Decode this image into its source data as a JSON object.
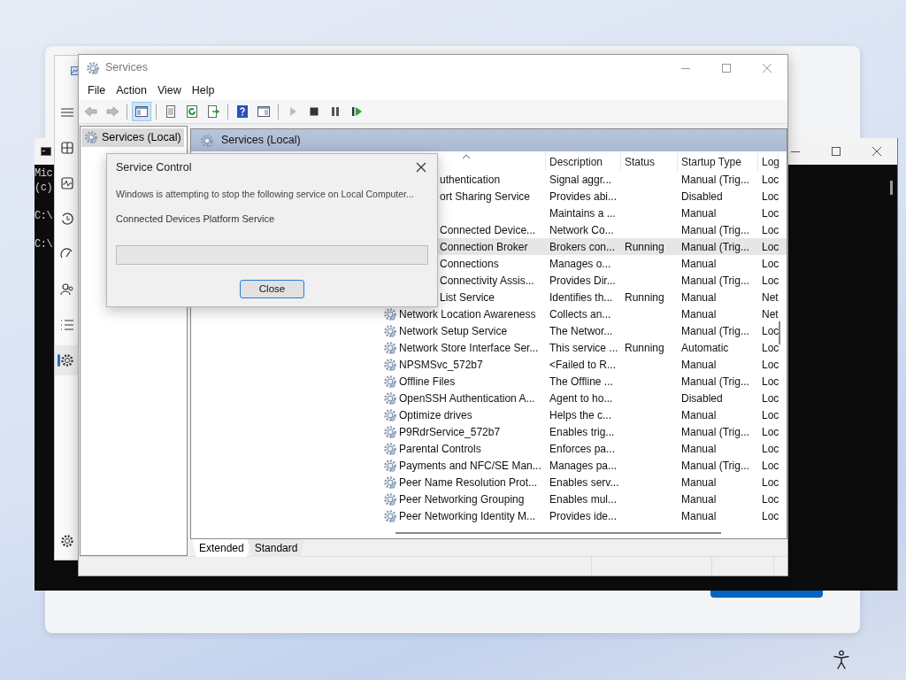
{
  "console": {
    "lines": [
      {
        "kind": "output",
        "text": "Mic"
      },
      {
        "kind": "output",
        "text": "(c)"
      },
      {
        "kind": "prompt",
        "text": "C:\\"
      },
      {
        "kind": "prompt",
        "text": "C:\\"
      }
    ]
  },
  "task_manager": {
    "nav": [
      {
        "kind": "menu",
        "selected": false
      },
      {
        "kind": "processes",
        "selected": false
      },
      {
        "kind": "performance",
        "selected": false
      },
      {
        "kind": "history",
        "selected": false
      },
      {
        "kind": "startup",
        "selected": false
      },
      {
        "kind": "users",
        "selected": false
      },
      {
        "kind": "details",
        "selected": false
      },
      {
        "kind": "services",
        "selected": true
      },
      {
        "kind": "settings",
        "selected": false
      }
    ]
  },
  "services": {
    "title": "Services",
    "menu": [
      "File",
      "Action",
      "View",
      "Help"
    ],
    "toolbar": [
      [
        {
          "kind": "back",
          "disabled": true,
          "pressed": false
        },
        {
          "kind": "forward",
          "disabled": true,
          "pressed": false
        }
      ],
      [
        {
          "kind": "tree",
          "disabled": false,
          "pressed": true
        }
      ],
      [
        {
          "kind": "properties",
          "disabled": false,
          "pressed": false
        },
        {
          "kind": "refresh",
          "disabled": false,
          "pressed": false
        },
        {
          "kind": "export",
          "disabled": false,
          "pressed": false
        }
      ],
      [
        {
          "kind": "help",
          "disabled": false,
          "pressed": false
        },
        {
          "kind": "action_pane",
          "disabled": false,
          "pressed": false
        }
      ],
      [
        {
          "kind": "start",
          "disabled": true,
          "pressed": false
        },
        {
          "kind": "stop",
          "disabled": false,
          "pressed": false
        },
        {
          "kind": "pause",
          "disabled": false,
          "pressed": false
        },
        {
          "kind": "resume",
          "disabled": false,
          "pressed": false
        }
      ]
    ],
    "tree": [
      {
        "label": "Services (Local)",
        "selected": true
      }
    ],
    "pane_title": "Services (Local)",
    "columns": [
      {
        "sorted": true
      },
      {
        "label": "Description"
      },
      {
        "label": "Status"
      },
      {
        "label": "Startup Type"
      },
      {
        "label": "Log"
      }
    ],
    "rows": [
      {
        "kind": "covered",
        "name": "uthentication",
        "description": "Signal aggr...",
        "startup_type": "Manual (Trig...",
        "log_on_as": "Loc",
        "selected": false
      },
      {
        "kind": "covered",
        "name": "ort Sharing Service",
        "description": "Provides abi...",
        "startup_type": "Disabled",
        "log_on_as": "Loc",
        "selected": false
      },
      {
        "kind": "covered",
        "description": "Maintains a ...",
        "startup_type": "Manual",
        "log_on_as": "Loc",
        "selected": false
      },
      {
        "kind": "covered",
        "name": "Connected Device...",
        "description": "Network Co...",
        "startup_type": "Manual (Trig...",
        "log_on_as": "Loc",
        "selected": false
      },
      {
        "kind": "covered",
        "name": "Connection Broker",
        "description": "Brokers con...",
        "status": "Running",
        "startup_type": "Manual (Trig...",
        "log_on_as": "Loc",
        "selected": true
      },
      {
        "kind": "covered",
        "name": "Connections",
        "description": "Manages o...",
        "startup_type": "Manual",
        "log_on_as": "Loc",
        "selected": false
      },
      {
        "kind": "covered",
        "name": "Connectivity Assis...",
        "description": "Provides Dir...",
        "startup_type": "Manual (Trig...",
        "log_on_as": "Loc",
        "selected": false
      },
      {
        "kind": "covered",
        "name": "List Service",
        "description": "Identifies th...",
        "status": "Running",
        "startup_type": "Manual",
        "log_on_as": "Net",
        "selected": false
      },
      {
        "kind": "service",
        "name": "Network Location Awareness",
        "description": "Collects an...",
        "startup_type": "Manual",
        "log_on_as": "Net",
        "selected": false
      },
      {
        "kind": "service",
        "name": "Network Setup Service",
        "description": "The Networ...",
        "startup_type": "Manual (Trig...",
        "log_on_as": "Loc",
        "selected": false
      },
      {
        "kind": "service",
        "name": "Network Store Interface Ser...",
        "description": "This service ...",
        "status": "Running",
        "startup_type": "Automatic",
        "log_on_as": "Loc",
        "selected": false
      },
      {
        "kind": "service",
        "name": "NPSMSvc_572b7",
        "description": "<Failed to R...",
        "startup_type": "Manual",
        "log_on_as": "Loc",
        "selected": false
      },
      {
        "kind": "service",
        "name": "Offline Files",
        "description": "The Offline ...",
        "startup_type": "Manual (Trig...",
        "log_on_as": "Loc",
        "selected": false
      },
      {
        "kind": "service",
        "name": "OpenSSH Authentication A...",
        "description": "Agent to ho...",
        "startup_type": "Disabled",
        "log_on_as": "Loc",
        "selected": false
      },
      {
        "kind": "service",
        "name": "Optimize drives",
        "description": "Helps the c...",
        "startup_type": "Manual",
        "log_on_as": "Loc",
        "selected": false
      },
      {
        "kind": "service",
        "name": "P9RdrService_572b7",
        "description": "Enables trig...",
        "startup_type": "Manual (Trig...",
        "log_on_as": "Loc",
        "selected": false
      },
      {
        "kind": "service",
        "name": "Parental Controls",
        "description": "Enforces pa...",
        "startup_type": "Manual",
        "log_on_as": "Loc",
        "selected": false
      },
      {
        "kind": "service",
        "name": "Payments and NFC/SE Man...",
        "description": "Manages pa...",
        "startup_type": "Manual (Trig...",
        "log_on_as": "Loc",
        "selected": false
      },
      {
        "kind": "service",
        "name": "Peer Name Resolution Prot...",
        "description": "Enables serv...",
        "startup_type": "Manual",
        "log_on_as": "Loc",
        "selected": false
      },
      {
        "kind": "service",
        "name": "Peer Networking Grouping",
        "description": "Enables mul...",
        "startup_type": "Manual",
        "log_on_as": "Loc",
        "selected": false
      },
      {
        "kind": "service",
        "name": "Peer Networking Identity M...",
        "description": "Provides ide...",
        "startup_type": "Manual",
        "log_on_as": "Loc",
        "selected": false
      }
    ],
    "tabs": [
      {
        "label": "Extended",
        "selected": true
      },
      {
        "label": "Standard",
        "selected": false
      }
    ]
  },
  "dialog": {
    "title": "Service Control",
    "message": "Windows is attempting to stop the following service on Local Computer...",
    "service": "Connected Devices Platform Service",
    "progress": {
      "level": 0
    },
    "button": "Close"
  }
}
